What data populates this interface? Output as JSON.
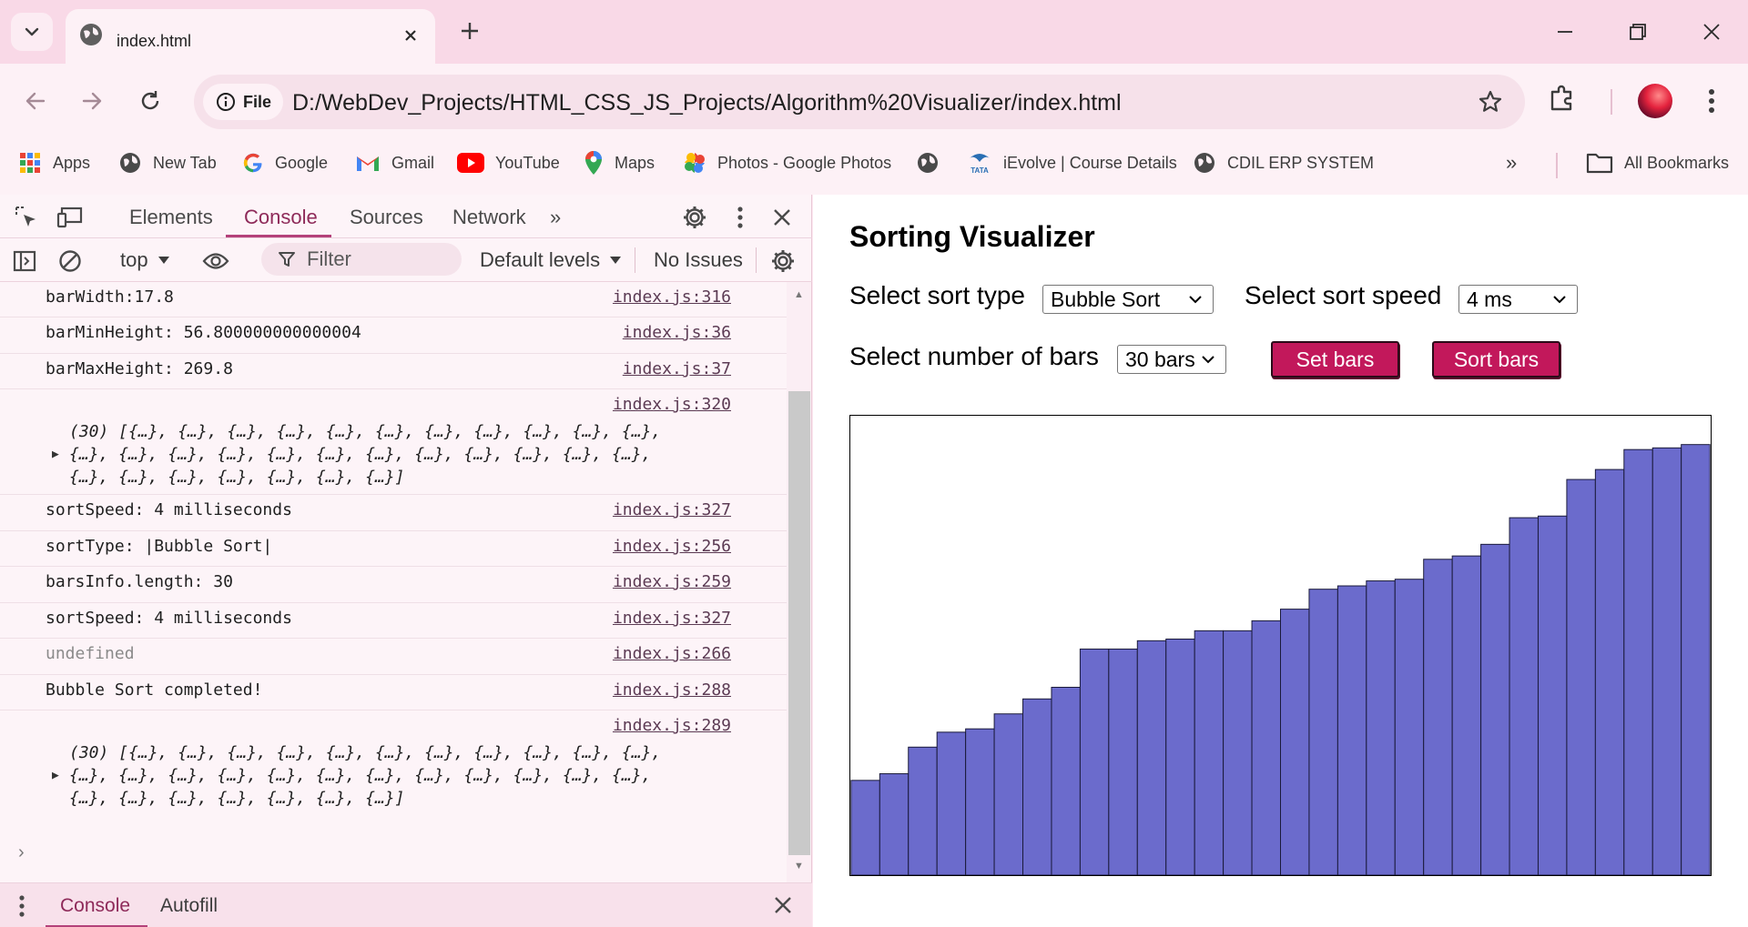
{
  "browser": {
    "tab_title": "index.html",
    "site_chip": "File",
    "url": "D:/WebDev_Projects/HTML_CSS_JS_Projects/Algorithm%20Visualizer/index.html",
    "bookmarks": [
      {
        "label": "Apps",
        "icon": "apps-grid-icon"
      },
      {
        "label": "New Tab",
        "icon": "globe-icon"
      },
      {
        "label": "Google",
        "icon": "google-icon"
      },
      {
        "label": "Gmail",
        "icon": "gmail-icon"
      },
      {
        "label": "YouTube",
        "icon": "youtube-icon"
      },
      {
        "label": "Maps",
        "icon": "maps-icon"
      },
      {
        "label": "Photos - Google Photos",
        "icon": "photos-icon"
      },
      {
        "label": "",
        "icon": "globe-icon"
      },
      {
        "label": "iEvolve | Course Details",
        "icon": "tata-icon"
      },
      {
        "label": "CDIL ERP SYSTEM",
        "icon": "globe-icon"
      }
    ],
    "more_bookmarks": "»",
    "all_bookmarks": "All Bookmarks"
  },
  "devtools": {
    "tabs": [
      "Elements",
      "Console",
      "Sources",
      "Network"
    ],
    "more_tabs": "»",
    "context": "top",
    "filter_placeholder": "Filter",
    "levels": "Default levels",
    "issues": "No Issues",
    "logs": [
      {
        "msg": "barWidth:17.8",
        "src": "index.js:316"
      },
      {
        "msg": "barMinHeight: 56.800000000000004",
        "src": "index.js:36"
      },
      {
        "msg": "barMaxHeight: 269.8",
        "src": "index.js:37"
      },
      {
        "src": "index.js:320",
        "array": [
          "(30) [{…}, {…}, {…}, {…}, {…}, {…}, {…}, {…}, {…}, {…}, {…},",
          "{…}, {…}, {…}, {…}, {…}, {…}, {…}, {…}, {…}, {…}, {…}, {…},",
          "{…}, {…}, {…}, {…}, {…}, {…}, {…}]"
        ]
      },
      {
        "msg": "sortSpeed: 4 milliseconds",
        "src": "index.js:327"
      },
      {
        "msg": "sortType: |Bubble Sort|",
        "src": "index.js:256"
      },
      {
        "msg": "barsInfo.length: 30",
        "src": "index.js:259"
      },
      {
        "msg": "sortSpeed: 4 milliseconds",
        "src": "index.js:327"
      },
      {
        "msg": "undefined",
        "src": "index.js:266",
        "muted": true
      },
      {
        "msg": "Bubble Sort completed!",
        "src": "index.js:288"
      },
      {
        "src": "index.js:289",
        "array": [
          "(30) [{…}, {…}, {…}, {…}, {…}, {…}, {…}, {…}, {…}, {…}, {…},",
          "{…}, {…}, {…}, {…}, {…}, {…}, {…}, {…}, {…}, {…}, {…}, {…},",
          "{…}, {…}, {…}, {…}, {…}, {…}, {…}]"
        ]
      }
    ],
    "prompt": "›",
    "drawer_tabs": [
      "Console",
      "Autofill"
    ]
  },
  "page": {
    "title": "Sorting Visualizer",
    "sort_type_label": "Select sort type",
    "sort_type_value": "Bubble Sort",
    "sort_speed_label": "Select sort speed",
    "sort_speed_value": "4 ms",
    "bars_label": "Select number of bars",
    "bars_value": "30 bars",
    "set_bars_button": "Set bars",
    "sort_bars_button": "Sort bars",
    "colors": {
      "bar": "#6b6bcc",
      "button": "#c2185b",
      "accent": "#b4417a"
    }
  },
  "chart_data": {
    "type": "bar",
    "values": [
      57,
      61,
      77,
      86,
      88,
      97,
      106,
      113,
      136,
      136,
      141,
      142,
      147,
      147,
      153,
      160,
      172,
      174,
      177,
      178,
      190,
      192,
      199,
      215,
      216,
      238,
      244,
      256,
      257,
      259
    ],
    "ylim": [
      0,
      269.8
    ],
    "bar_color": "#6b6bcc",
    "grid": false
  }
}
